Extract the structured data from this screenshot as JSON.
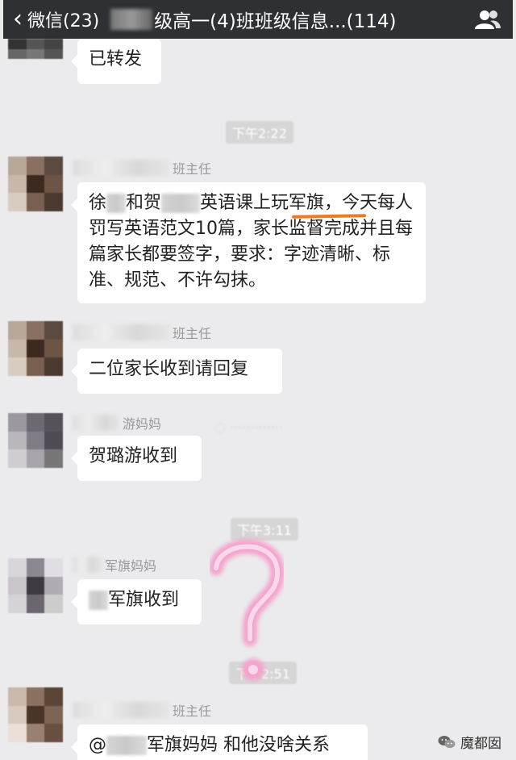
{
  "header": {
    "back_label": "微信(23)",
    "title": "级高一(4)班班级信息...(114)"
  },
  "messages": [
    {
      "text": "已转发"
    },
    {
      "timestamp": "下午2:22"
    },
    {
      "sender": "班主任",
      "part1": "徐",
      "part2": "和贺",
      "part3": "英语课上玩军旗，今天每人罚写英语范文10篇，家长监督完成并且每篇家长都要签字，要求：字迹清晰、标准、规范、不许勾抹。"
    },
    {
      "sender": "班主任",
      "text": "二位家长收到请回复"
    },
    {
      "sender": "游妈妈",
      "text": "贺璐游收到"
    },
    {
      "timestamp": "下午3:11"
    },
    {
      "sender": "军旗妈妈",
      "text": "军旗收到"
    },
    {
      "timestamp": "下午2:51"
    },
    {
      "sender": "班主任",
      "part1": "@",
      "part2": "军旗妈妈 和他没啥关系"
    }
  ],
  "watermark": "魔都囡",
  "colors": {
    "header_bg": "#2f3033",
    "underline": "#f07a20",
    "question_mark": "#f4a3cc"
  }
}
